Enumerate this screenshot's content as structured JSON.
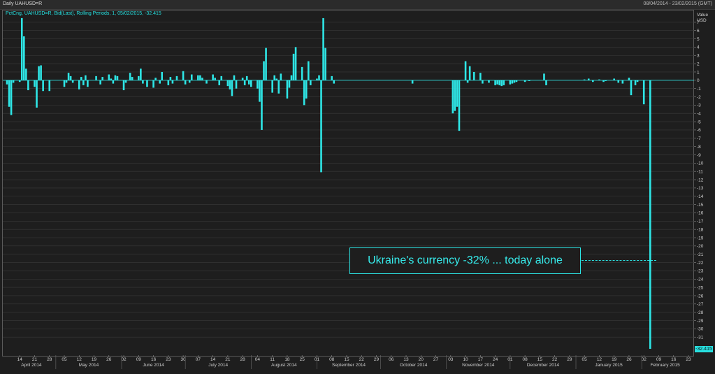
{
  "window": {
    "title": "Daily UAHUSD=R",
    "date_range": "08/04/2014 - 23/02/2015 (GMT)"
  },
  "legend": {
    "text": "PctCng, UAHUSD=R, Bid(Last), Rolling Periods, 1, 05/02/2015, -32.415"
  },
  "last_value_label": "-32.415",
  "annotation": {
    "text": "Ukraine's currency -32% ... today alone"
  },
  "colors": {
    "series": "#2ee6e6",
    "background": "#1e1e1e",
    "grid": "#3a3a3a"
  },
  "chart_data": {
    "type": "bar",
    "y_axis_title": "Value USD",
    "ylim": [
      -32.5,
      8
    ],
    "y_ticks": [
      7,
      6,
      5,
      4,
      3,
      2,
      1,
      0,
      -1,
      -2,
      -3,
      -4,
      -5,
      -6,
      -7,
      -8,
      -9,
      -10,
      -11,
      -12,
      -13,
      -14,
      -15,
      -16,
      -17,
      -18,
      -19,
      -20,
      -21,
      -22,
      -23,
      -24,
      -25,
      -26,
      -27,
      -28,
      -29,
      -30,
      -31
    ],
    "grid": true,
    "x_tick_labels": [
      "14",
      "21",
      "28",
      "05",
      "12",
      "19",
      "26",
      "02",
      "09",
      "16",
      "23",
      "30",
      "07",
      "14",
      "21",
      "28",
      "04",
      "11",
      "18",
      "25",
      "01",
      "08",
      "15",
      "22",
      "29",
      "06",
      "13",
      "20",
      "27",
      "03",
      "10",
      "17",
      "24",
      "01",
      "08",
      "15",
      "22",
      "29",
      "05",
      "12",
      "19",
      "26",
      "02",
      "09",
      "16",
      "23"
    ],
    "month_labels": [
      "April 2014",
      "May 2014",
      "June 2014",
      "July 2014",
      "August 2014",
      "September 2014",
      "October 2014",
      "November 2014",
      "December 2014",
      "January 2015",
      "February 2015"
    ],
    "series": [
      {
        "name": "UAHUSD=R",
        "x_start": "2014-04-08",
        "x_end": "2015-02-23",
        "points": [
          [
            "2014-04-08",
            -0.5
          ],
          [
            "2014-04-09",
            -3.2
          ],
          [
            "2014-04-10",
            -4.2
          ],
          [
            "2014-04-11",
            -0.3
          ],
          [
            "2014-04-14",
            -0.2
          ],
          [
            "2014-04-15",
            7.5
          ],
          [
            "2014-04-16",
            5.3
          ],
          [
            "2014-04-17",
            1.4
          ],
          [
            "2014-04-18",
            -1.2
          ],
          [
            "2014-04-21",
            -0.8
          ],
          [
            "2014-04-22",
            -3.3
          ],
          [
            "2014-04-23",
            1.7
          ],
          [
            "2014-04-24",
            1.8
          ],
          [
            "2014-04-25",
            -1.3
          ],
          [
            "2014-04-28",
            -1.3
          ],
          [
            "2014-05-05",
            -0.8
          ],
          [
            "2014-05-06",
            -0.3
          ],
          [
            "2014-05-07",
            0.9
          ],
          [
            "2014-05-08",
            0.5
          ],
          [
            "2014-05-09",
            -0.3
          ],
          [
            "2014-05-12",
            -1.1
          ],
          [
            "2014-05-13",
            0.4
          ],
          [
            "2014-05-14",
            -0.6
          ],
          [
            "2014-05-15",
            0.6
          ],
          [
            "2014-05-16",
            -0.8
          ],
          [
            "2014-05-20",
            0.5
          ],
          [
            "2014-05-22",
            -0.5
          ],
          [
            "2014-05-23",
            0.4
          ],
          [
            "2014-05-26",
            0.7
          ],
          [
            "2014-05-27",
            0.2
          ],
          [
            "2014-05-28",
            -0.4
          ],
          [
            "2014-05-29",
            0.6
          ],
          [
            "2014-05-30",
            0.5
          ],
          [
            "2014-06-02",
            -1.2
          ],
          [
            "2014-06-03",
            -0.3
          ],
          [
            "2014-06-05",
            0.9
          ],
          [
            "2014-06-06",
            0.4
          ],
          [
            "2014-06-09",
            0.5
          ],
          [
            "2014-06-10",
            1.4
          ],
          [
            "2014-06-11",
            -0.4
          ],
          [
            "2014-06-13",
            -0.8
          ],
          [
            "2014-06-16",
            -0.9
          ],
          [
            "2014-06-17",
            0.3
          ],
          [
            "2014-06-19",
            -0.4
          ],
          [
            "2014-06-20",
            1.0
          ],
          [
            "2014-06-23",
            -0.6
          ],
          [
            "2014-06-24",
            0.4
          ],
          [
            "2014-06-25",
            -0.4
          ],
          [
            "2014-06-27",
            0.5
          ],
          [
            "2014-06-30",
            1.1
          ],
          [
            "2014-07-01",
            -0.5
          ],
          [
            "2014-07-03",
            -0.3
          ],
          [
            "2014-07-04",
            0.7
          ],
          [
            "2014-07-07",
            0.6
          ],
          [
            "2014-07-08",
            0.6
          ],
          [
            "2014-07-09",
            0.3
          ],
          [
            "2014-07-11",
            -0.4
          ],
          [
            "2014-07-14",
            0.7
          ],
          [
            "2014-07-15",
            0.3
          ],
          [
            "2014-07-17",
            -0.6
          ],
          [
            "2014-07-18",
            0.5
          ],
          [
            "2014-07-21",
            -0.7
          ],
          [
            "2014-07-22",
            -1.1
          ],
          [
            "2014-07-23",
            -1.9
          ],
          [
            "2014-07-24",
            0.6
          ],
          [
            "2014-07-25",
            -1.0
          ],
          [
            "2014-07-28",
            0.3
          ],
          [
            "2014-07-29",
            -0.6
          ],
          [
            "2014-07-30",
            0.5
          ],
          [
            "2014-07-31",
            -0.5
          ],
          [
            "2014-08-01",
            -0.8
          ],
          [
            "2014-08-04",
            -1.0
          ],
          [
            "2014-08-05",
            -2.6
          ],
          [
            "2014-08-06",
            -6.0
          ],
          [
            "2014-08-07",
            2.3
          ],
          [
            "2014-08-08",
            3.9
          ],
          [
            "2014-08-11",
            -1.5
          ],
          [
            "2014-08-12",
            0.6
          ],
          [
            "2014-08-13",
            0.2
          ],
          [
            "2014-08-14",
            -1.6
          ],
          [
            "2014-08-15",
            0.8
          ],
          [
            "2014-08-18",
            -2.2
          ],
          [
            "2014-08-19",
            -0.9
          ],
          [
            "2014-08-20",
            0.6
          ],
          [
            "2014-08-21",
            3.2
          ],
          [
            "2014-08-22",
            4.0
          ],
          [
            "2014-08-25",
            1.6
          ],
          [
            "2014-08-26",
            -3.0
          ],
          [
            "2014-08-27",
            -2.2
          ],
          [
            "2014-08-28",
            2.3
          ],
          [
            "2014-08-29",
            -0.6
          ],
          [
            "2014-09-01",
            0.2
          ],
          [
            "2014-09-02",
            0.6
          ],
          [
            "2014-09-03",
            -11.1
          ],
          [
            "2014-09-04",
            7.5
          ],
          [
            "2014-09-05",
            3.9
          ],
          [
            "2014-09-08",
            0.5
          ],
          [
            "2014-09-09",
            -0.4
          ],
          [
            "2014-10-16",
            -0.4
          ],
          [
            "2014-11-04",
            -4.0
          ],
          [
            "2014-11-05",
            -3.7
          ],
          [
            "2014-11-06",
            -3.2
          ],
          [
            "2014-11-07",
            -6.1
          ],
          [
            "2014-11-10",
            2.3
          ],
          [
            "2014-11-11",
            -0.3
          ],
          [
            "2014-11-12",
            1.7
          ],
          [
            "2014-11-14",
            1.0
          ],
          [
            "2014-11-17",
            0.9
          ],
          [
            "2014-11-18",
            -0.4
          ],
          [
            "2014-11-21",
            -0.3
          ],
          [
            "2014-11-24",
            -0.6
          ],
          [
            "2014-11-25",
            -0.5
          ],
          [
            "2014-11-26",
            -0.6
          ],
          [
            "2014-11-27",
            -0.7
          ],
          [
            "2014-11-28",
            -0.6
          ],
          [
            "2014-12-01",
            -0.5
          ],
          [
            "2014-12-02",
            -0.4
          ],
          [
            "2014-12-03",
            -0.3
          ],
          [
            "2014-12-04",
            -0.2
          ],
          [
            "2014-12-08",
            -0.2
          ],
          [
            "2014-12-10",
            -0.1
          ],
          [
            "2014-12-17",
            0.8
          ],
          [
            "2014-12-18",
            -0.6
          ],
          [
            "2015-01-05",
            0.1
          ],
          [
            "2015-01-07",
            0.2
          ],
          [
            "2015-01-09",
            -0.2
          ],
          [
            "2015-01-12",
            0.1
          ],
          [
            "2015-01-14",
            -0.2
          ],
          [
            "2015-01-15",
            -0.1
          ],
          [
            "2015-01-19",
            0.2
          ],
          [
            "2015-01-21",
            -0.3
          ],
          [
            "2015-01-23",
            -0.4
          ],
          [
            "2015-01-26",
            0.3
          ],
          [
            "2015-01-27",
            -1.8
          ],
          [
            "2015-01-29",
            -0.6
          ],
          [
            "2015-01-30",
            -0.2
          ],
          [
            "2015-02-02",
            -2.9
          ],
          [
            "2015-02-05",
            -32.415
          ]
        ]
      }
    ]
  }
}
